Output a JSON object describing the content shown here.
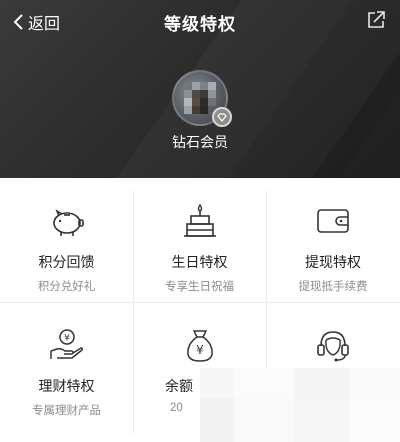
{
  "nav": {
    "back_label": "返回",
    "title": "等级特权"
  },
  "profile": {
    "member_level": "钻石会员"
  },
  "privileges": [
    {
      "name": "积分回馈",
      "desc": "积分兑好礼",
      "icon": "piggy-bank-icon"
    },
    {
      "name": "生日特权",
      "desc": "专享生日祝福",
      "icon": "birthday-cake-icon"
    },
    {
      "name": "提现特权",
      "desc": "提现抵手续费",
      "icon": "wallet-icon"
    },
    {
      "name": "理财特权",
      "desc": "专属理财产品",
      "icon": "money-hand-icon"
    },
    {
      "name": "余额",
      "desc": "20",
      "icon": "money-bag-icon"
    },
    {
      "name": "",
      "desc": "",
      "icon": "headset-service-icon"
    }
  ],
  "colors": {
    "header_bg": "#2c2c2c",
    "icon_stroke": "#333333",
    "desc_text": "#8c8c8c"
  }
}
